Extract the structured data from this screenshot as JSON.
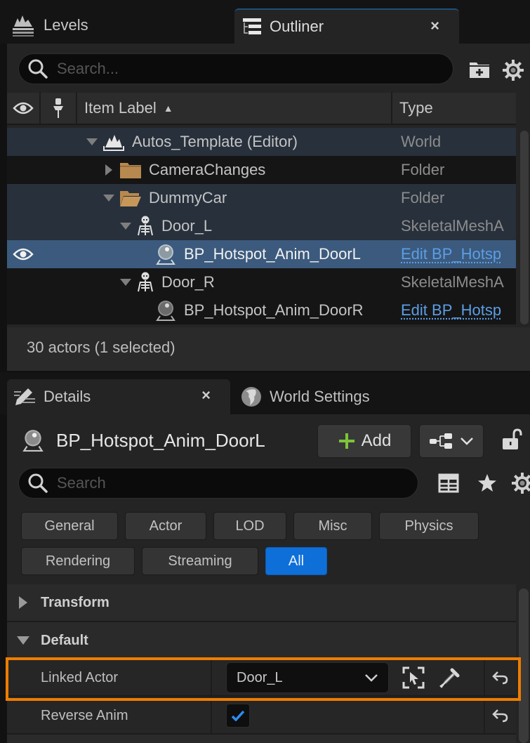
{
  "outliner_panel": {
    "tabs": [
      {
        "label": "Levels",
        "icon": "levels-icon",
        "active": false
      },
      {
        "label": "Outliner",
        "icon": "outliner-list-icon",
        "active": true,
        "close": "×"
      }
    ],
    "search": {
      "placeholder": "Search...",
      "value": ""
    },
    "toolbar_icons": [
      "add-folder-icon",
      "gear-icon"
    ],
    "columns": {
      "visibility": "eye-icon",
      "pin": "pin-icon",
      "label": "Item Label",
      "sort_indicator": "▲",
      "type": "Type"
    },
    "rows": [
      {
        "label": "Autos_Template (Editor)",
        "type": "World",
        "icon": "world-level-icon",
        "expanded": true,
        "depth": 0,
        "style": "highlight"
      },
      {
        "label": "CameraChanges",
        "type": "Folder",
        "icon": "folder-closed-icon",
        "expanded": false,
        "depth": 1,
        "style": "dark"
      },
      {
        "label": "DummyCar",
        "type": "Folder",
        "icon": "folder-open-icon",
        "expanded": true,
        "depth": 1,
        "style": "highlight"
      },
      {
        "label": "Door_L",
        "type": "SkeletalMeshA",
        "icon": "skeleton-icon",
        "expanded": true,
        "depth": 2,
        "style": "highlight"
      },
      {
        "label": "BP_Hotspot_Anim_DoorL",
        "type": "Edit BP_Hotsp",
        "type_is_link": true,
        "icon": "hotspot-actor-icon",
        "depth": 3,
        "style": "selected",
        "visible_eye": true
      },
      {
        "label": "Door_R",
        "type": "SkeletalMeshA",
        "icon": "skeleton-icon",
        "expanded": true,
        "depth": 2,
        "style": "dark"
      },
      {
        "label": "BP_Hotspot_Anim_DoorR",
        "type": "Edit BP_Hotsp",
        "type_is_link": true,
        "icon": "hotspot-actor-icon",
        "depth": 3,
        "style": "dark"
      }
    ],
    "status": "30 actors (1 selected)"
  },
  "details_panel": {
    "tabs": [
      {
        "label": "Details",
        "icon": "details-pencil-icon",
        "active": true,
        "close": "×"
      },
      {
        "label": "World Settings",
        "icon": "globe-icon",
        "active": false
      }
    ],
    "actor_name": "BP_Hotspot_Anim_DoorL",
    "add_button": "Add",
    "search": {
      "placeholder": "Search",
      "value": ""
    },
    "filters_row1": [
      "General",
      "Actor",
      "LOD",
      "Misc",
      "Physics"
    ],
    "filters_row2": [
      "Rendering",
      "Streaming",
      "All"
    ],
    "active_filter": "All",
    "sections": [
      {
        "label": "Transform",
        "expanded": false
      },
      {
        "label": "Default",
        "expanded": true
      }
    ],
    "properties": [
      {
        "name": "Linked Actor",
        "value": "Door_L",
        "kind": "actor-picker",
        "highlighted": true
      },
      {
        "name": "Reverse Anim",
        "value": true,
        "kind": "checkbox"
      }
    ]
  },
  "colors": {
    "accent_blue": "#0f6fd8",
    "selection_row": "#3b5a7d",
    "highlight_outline": "#ef7d00",
    "link_text": "#5c9ee6",
    "add_plus": "#7dc43a",
    "folder": "#b8894f"
  }
}
